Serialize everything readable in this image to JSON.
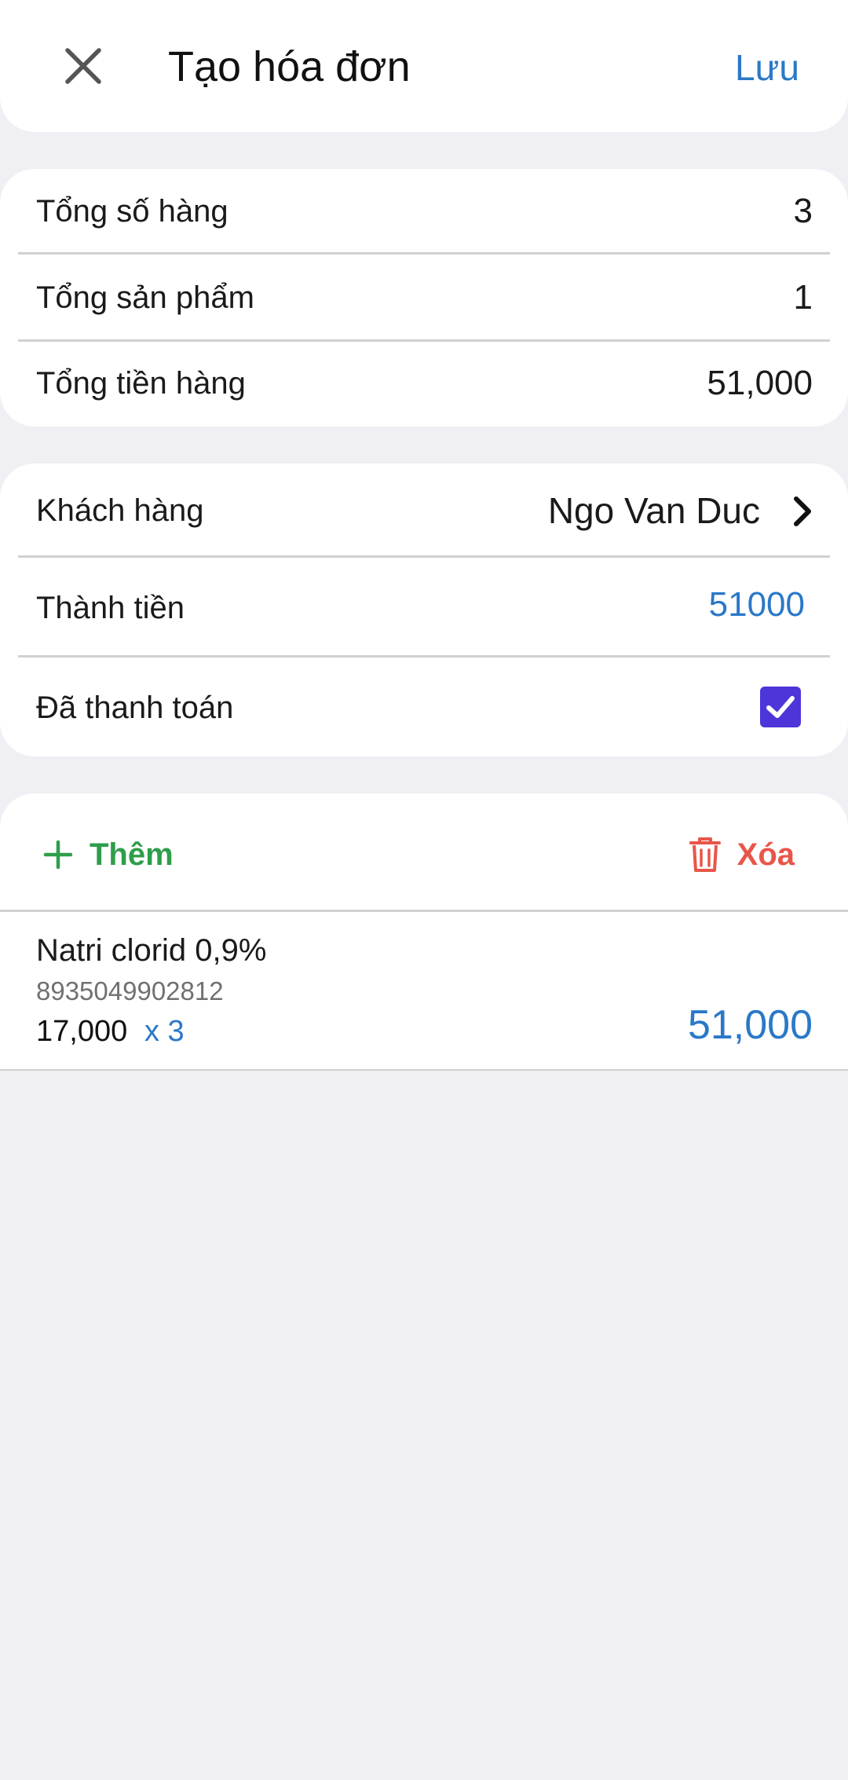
{
  "header": {
    "title": "Tạo hóa đơn",
    "save_label": "Lưu",
    "close_icon": "close-icon"
  },
  "summary": {
    "rows": [
      {
        "label": "Tổng số hàng",
        "value": "3"
      },
      {
        "label": "Tổng sản phẩm",
        "value": "1"
      },
      {
        "label": "Tổng tiền hàng",
        "value": "51,000"
      }
    ]
  },
  "details": {
    "customer_label": "Khách hàng",
    "customer_value": "Ngo Van Duc",
    "amount_label": "Thành tiền",
    "amount_value": "51000",
    "paid_label": "Đã thanh toán",
    "paid_checked": true
  },
  "actions": {
    "add_label": "Thêm",
    "delete_label": "Xóa"
  },
  "items": [
    {
      "name": "Natri clorid 0,9%",
      "code": "8935049902812",
      "price": "17,000",
      "qty": "x 3",
      "total": "51,000"
    }
  ],
  "colors": {
    "accent_blue": "#2a78c8",
    "add_green": "#2e9e4a",
    "delete_red": "#e8564a",
    "checkbox_purple": "#4c35d9",
    "background": "#f0eff4"
  }
}
